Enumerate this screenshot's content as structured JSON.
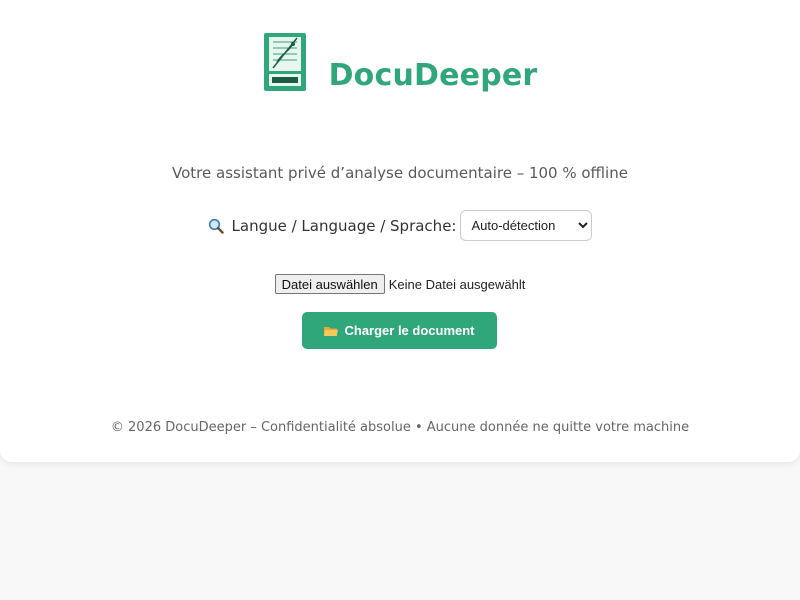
{
  "app": {
    "title": "DocuDeeper",
    "tagline": "Votre assistant privé d’analyse documentaire – 100 % offline"
  },
  "colors": {
    "accent": "#2fa77a",
    "background": "#f8f8f8",
    "card": "#ffffff"
  },
  "language": {
    "icon": "magnifier-icon",
    "label": "Langue / Language / Sprache:",
    "selected": "Auto-détection"
  },
  "file_input": {
    "button_label": "Datei auswählen",
    "status": "Keine Datei ausgewählt"
  },
  "upload": {
    "icon": "folder-icon",
    "label": "Charger le document"
  },
  "footer": {
    "text": "© 2026 DocuDeeper – Confidentialité absolue • Aucune donnée ne quitte votre machine"
  }
}
